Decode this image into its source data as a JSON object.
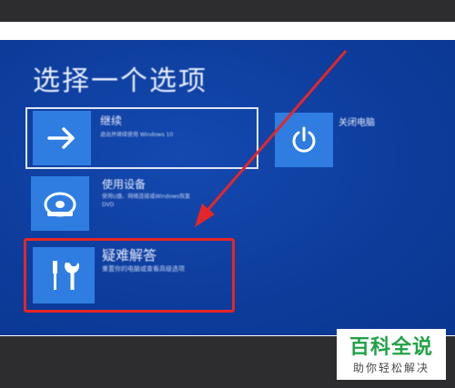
{
  "page": {
    "title": "选择一个选项"
  },
  "options": [
    {
      "title": "继续",
      "desc": "退出并继续使用 Windows 10",
      "icon": "arrow-right-icon"
    },
    {
      "title": "使用设备",
      "desc": "使用U盘、网络连接或Windows恢复\nDVD",
      "icon": "disc-device-icon"
    },
    {
      "title": "疑难解答",
      "desc": "重置你的电脑或查看高级选项",
      "icon": "tools-icon"
    },
    {
      "title": "关闭电脑",
      "desc": "",
      "icon": "power-icon"
    }
  ],
  "watermark": {
    "main": "百科全说",
    "sub": "助你轻松解决"
  },
  "colors": {
    "screen": "#0d3fa0",
    "tile": "#2f7de1",
    "highlight": "#e62626",
    "logo": "#22a246"
  }
}
